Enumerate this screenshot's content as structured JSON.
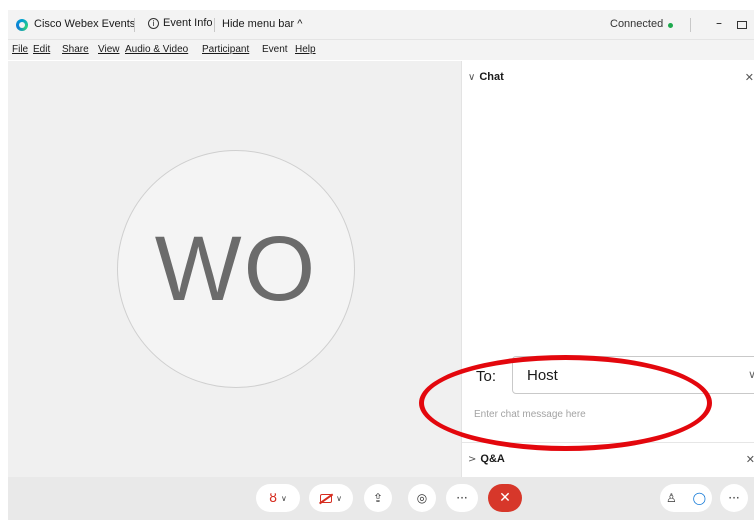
{
  "titlebar": {
    "app_title": "Cisco Webex Events",
    "event_info": "Event Info",
    "hide_menu": "Hide menu bar ^",
    "status": "Connected",
    "status_color": "#1ea94e",
    "minimize_icon": "minimize-icon",
    "maximize_icon": "maximize-icon",
    "close_icon": "close-icon"
  },
  "menubar": {
    "items": [
      "File",
      "Edit",
      "Share",
      "View",
      "Audio & Video",
      "Participant",
      "Event",
      "Help"
    ]
  },
  "stage": {
    "avatar_initials": "WO"
  },
  "chat": {
    "title": "Chat",
    "to_label": "To:",
    "to_value": "Host",
    "placeholder": "Enter chat message here"
  },
  "qa": {
    "title": "Q&A"
  },
  "controls": {
    "mute_icon": "mic-muted-icon",
    "video_icon": "video-off-icon",
    "share_icon": "share-icon",
    "record_icon": "record-icon",
    "more_icon": "more-icon",
    "end_icon": "end-meeting-icon",
    "participants_icon": "participants-icon",
    "chat_icon": "chat-icon",
    "end_color": "#d7372a",
    "mute_color": "#d62d20"
  },
  "annotation": {
    "color": "#e3070d"
  }
}
